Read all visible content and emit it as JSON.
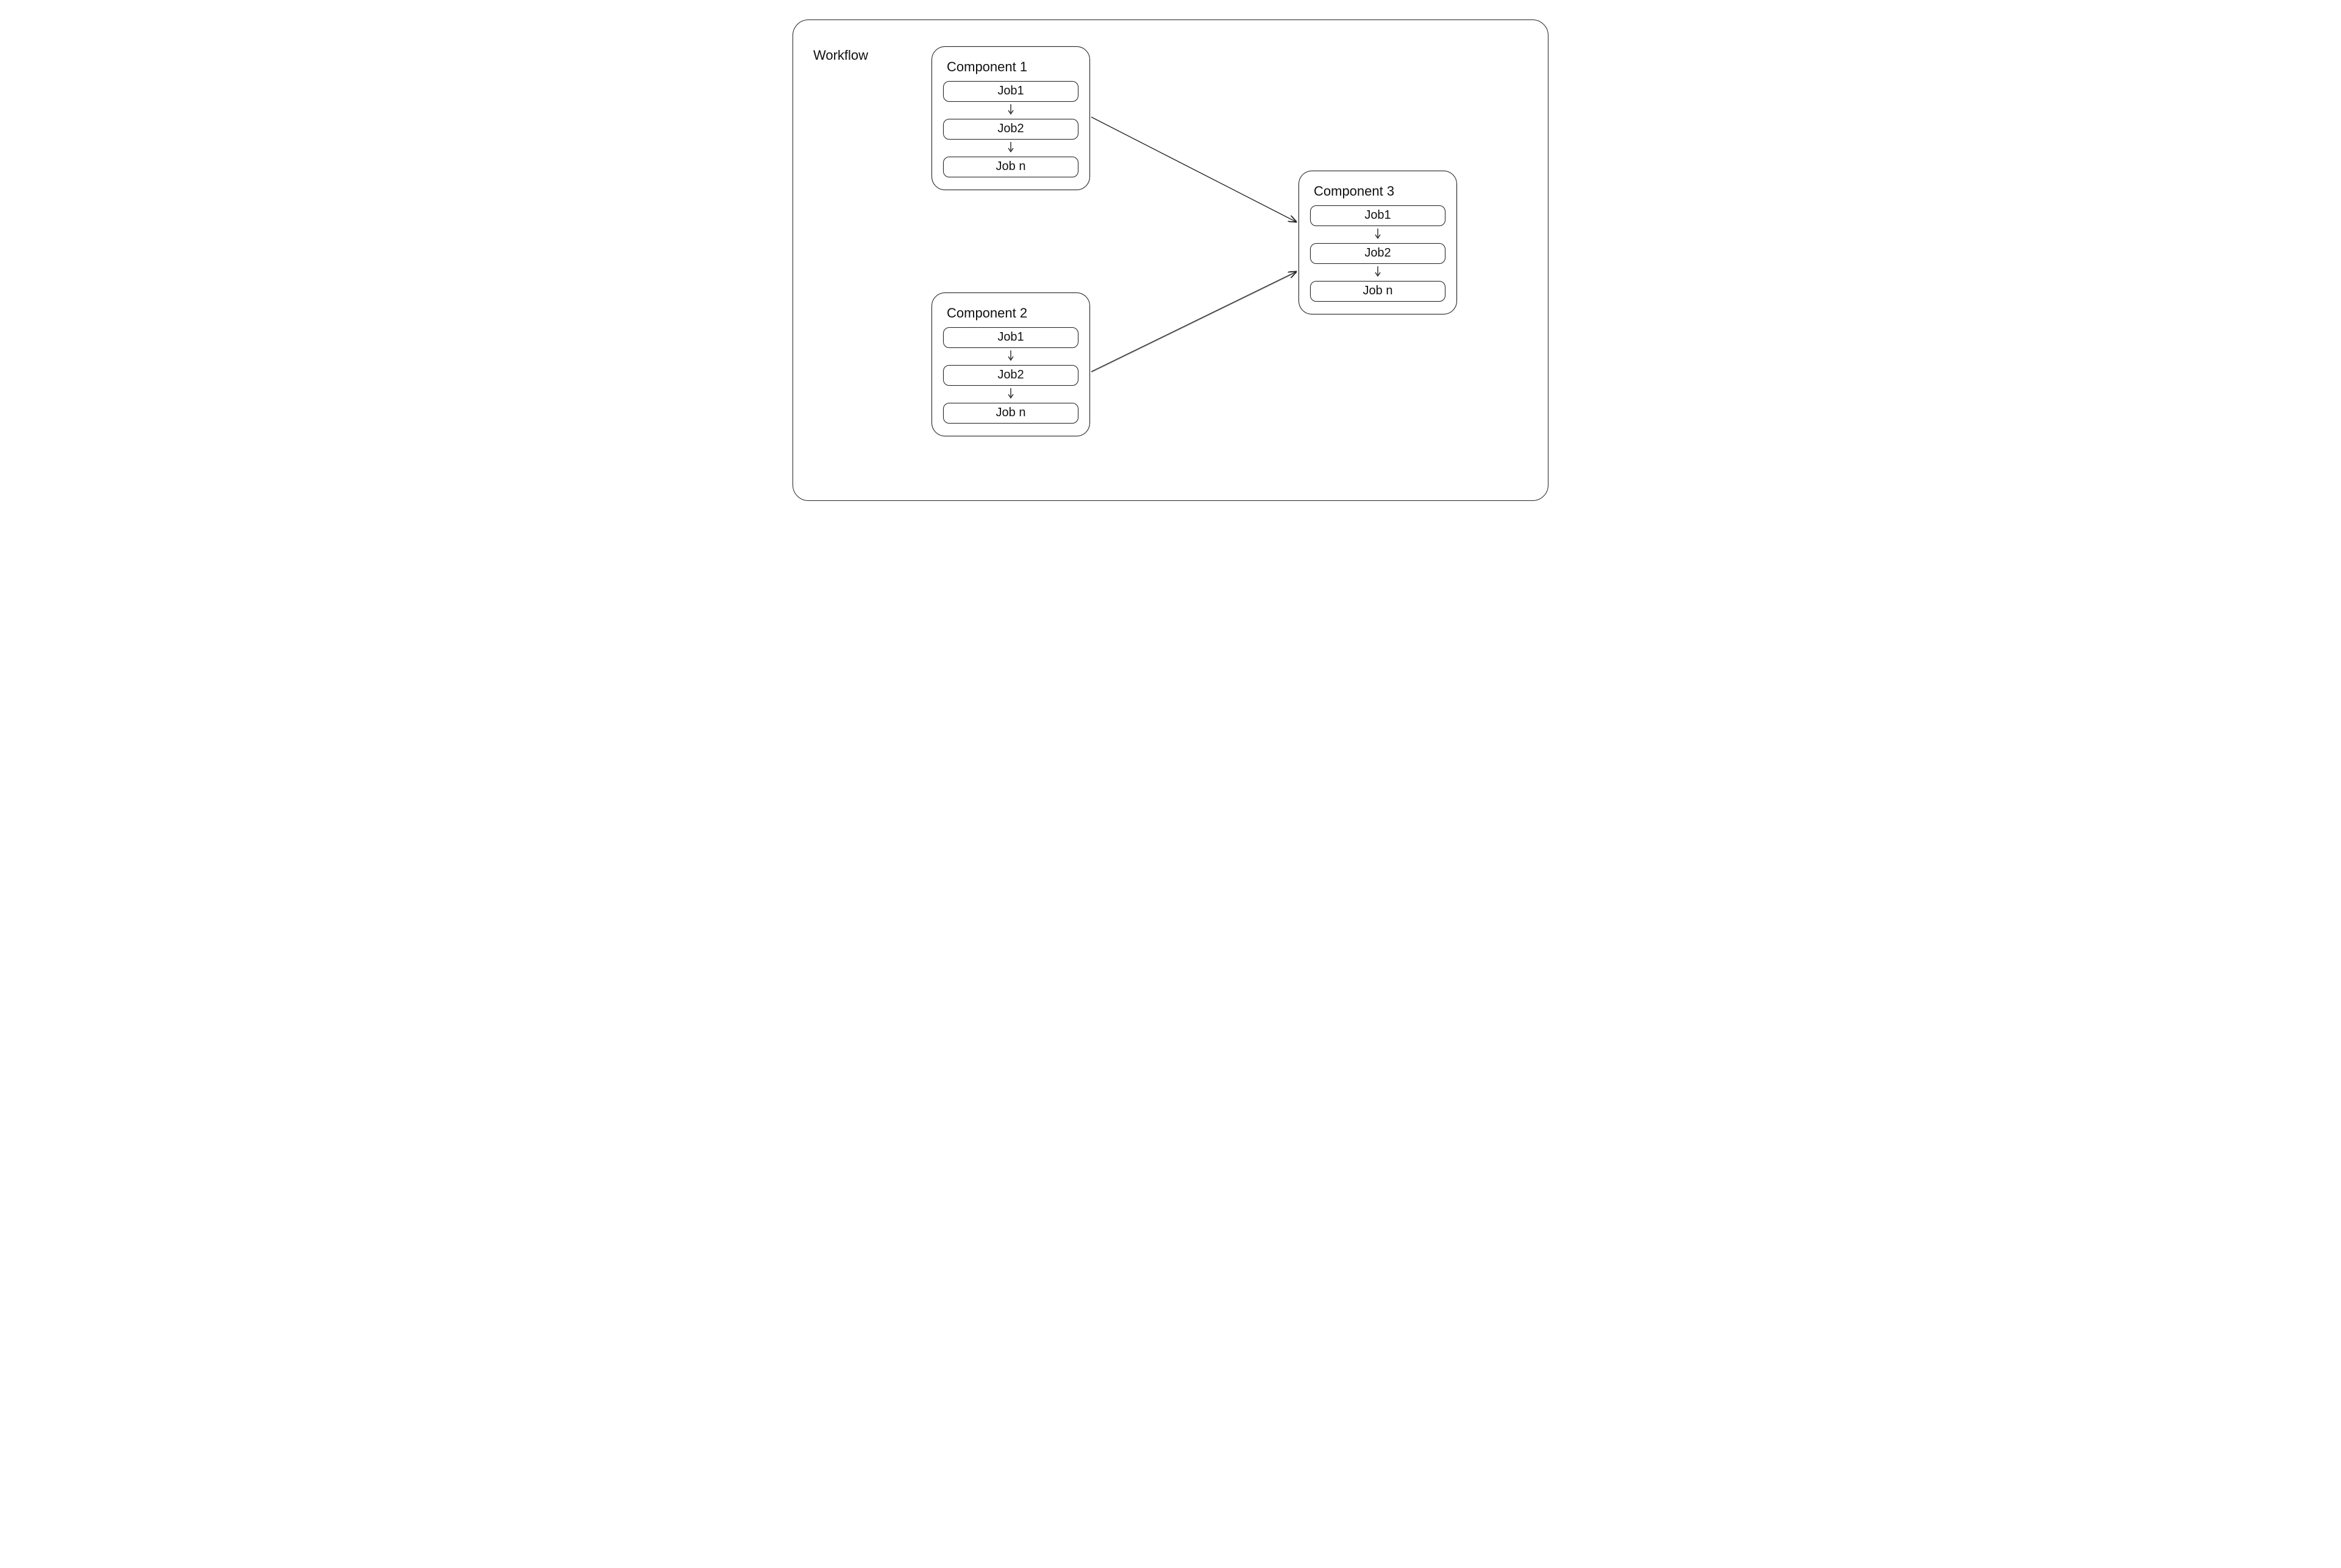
{
  "workflow": {
    "label": "Workflow",
    "components": [
      {
        "id": "component-1",
        "title": "Component 1",
        "jobs": [
          "Job1",
          "Job2",
          "Job n"
        ]
      },
      {
        "id": "component-2",
        "title": "Component 2",
        "jobs": [
          "Job1",
          "Job2",
          "Job n"
        ]
      },
      {
        "id": "component-3",
        "title": "Component 3",
        "jobs": [
          "Job1",
          "Job2",
          "Job n"
        ]
      }
    ],
    "connectors": [
      {
        "from": "component-1",
        "to": "component-3"
      },
      {
        "from": "component-2",
        "to": "component-3"
      }
    ]
  }
}
